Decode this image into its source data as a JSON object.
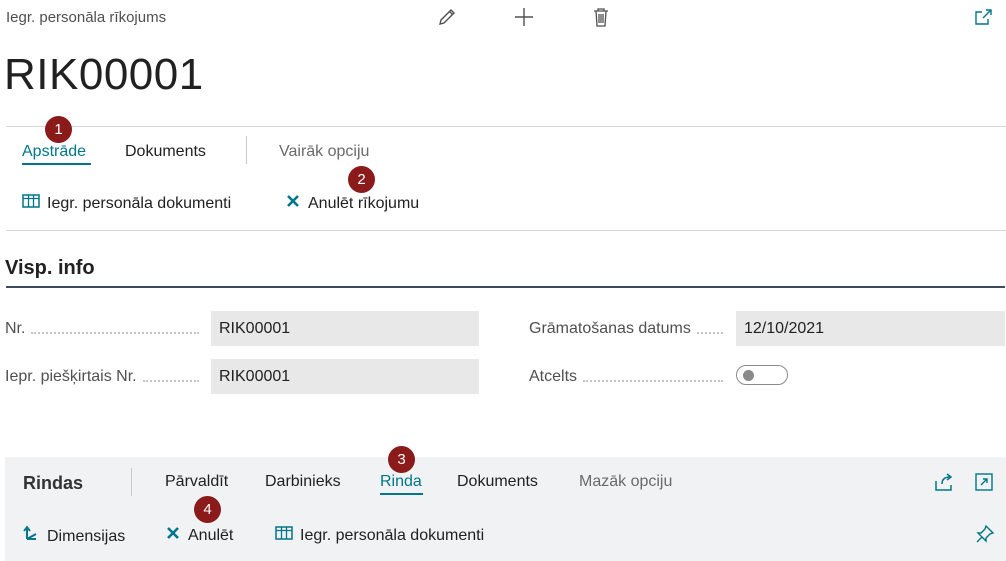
{
  "header": {
    "breadcrumb": "Iegr. personāla rīkojums",
    "icons": [
      "edit-icon",
      "add-icon",
      "delete-icon",
      "open-new-window-icon"
    ]
  },
  "page": {
    "title": "RIK00001"
  },
  "action_bar": {
    "tabs": [
      {
        "label": "Apstrāde",
        "active": true
      },
      {
        "label": "Dokuments",
        "active": false
      }
    ],
    "more_label": "Vairāk opciju",
    "actions": [
      {
        "label": "Iegr. personāla dokumenti",
        "icon": "table-icon"
      },
      {
        "label": "Anulēt rīkojumu",
        "icon": "close-icon"
      }
    ]
  },
  "general": {
    "title": "Visp. info",
    "fields": {
      "no": {
        "label": "Nr.",
        "value": "RIK00001"
      },
      "assigned_no": {
        "label": "Iepr. piešķirtais Nr.",
        "value": "RIK00001"
      },
      "posting_date": {
        "label": "Grāmatošanas datums",
        "value": "12/10/2021"
      },
      "cancelled": {
        "label": "Atcelts",
        "value": false
      }
    }
  },
  "lines": {
    "title": "Rindas",
    "tabs": [
      {
        "label": "Pārvaldīt",
        "active": false
      },
      {
        "label": "Darbinieks",
        "active": false
      },
      {
        "label": "Rinda",
        "active": true
      },
      {
        "label": "Dokuments",
        "active": false
      }
    ],
    "less_label": "Mazāk opciju",
    "actions": [
      {
        "label": "Dimensijas",
        "icon": "dimensions-icon"
      },
      {
        "label": "Anulēt",
        "icon": "close-icon"
      },
      {
        "label": "Iegr. personāla dokumenti",
        "icon": "table-icon"
      }
    ],
    "icons": [
      "share-icon",
      "expand-icon",
      "pin-icon"
    ]
  },
  "callouts": [
    "1",
    "2",
    "3",
    "4"
  ],
  "colors": {
    "accent": "#00768a",
    "badge": "#8b1a1a",
    "field_bg": "#e8e8e8",
    "panel_bg": "#f1f2f3"
  }
}
